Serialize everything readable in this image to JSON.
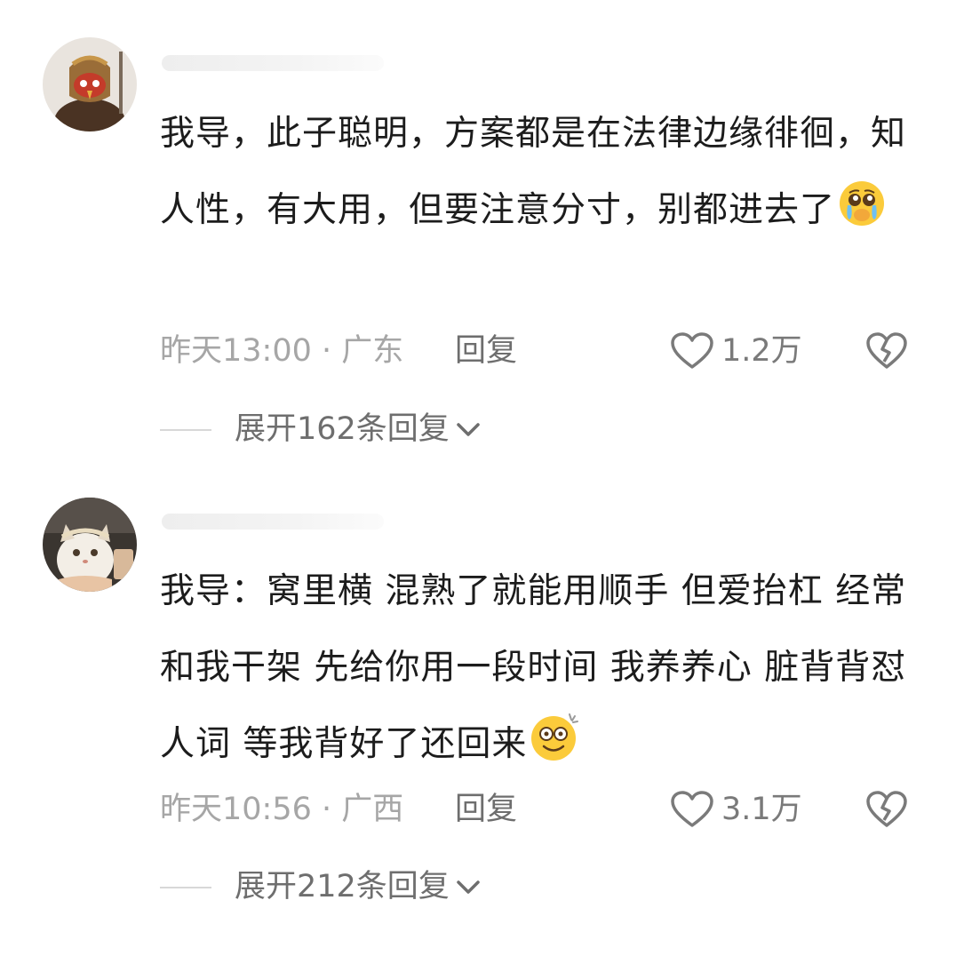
{
  "comments": [
    {
      "text": "我导，此子聪明，方案都是在法律边缘徘徊，知人性，有大用，但要注意分寸，别都进去了",
      "emoji": "pleading-tearful-face-emoji",
      "time_location": "昨天13:00 · 广东",
      "reply_label": "回复",
      "likes": "1.2万",
      "expand_label": "展开162条回复"
    },
    {
      "text": "我导：窝里横 混熟了就能用顺手 但爱抬杠 经常和我干架 先给你用一段时间 我养养心 脏背背怼人词 等我背好了还回来",
      "emoji": "dizzy-smiling-face-emoji",
      "time_location": "昨天10:56 · 广西",
      "reply_label": "回复",
      "likes": "3.1万",
      "expand_label": "展开212条回复"
    }
  ],
  "icons": {
    "like": "heart-outline-icon",
    "dislike": "broken-heart-icon",
    "expand": "chevron-down-icon"
  },
  "colors": {
    "text": "#1c1c1c",
    "meta": "#a6a6a6",
    "action": "#6e6e6e",
    "background": "#ffffff"
  }
}
